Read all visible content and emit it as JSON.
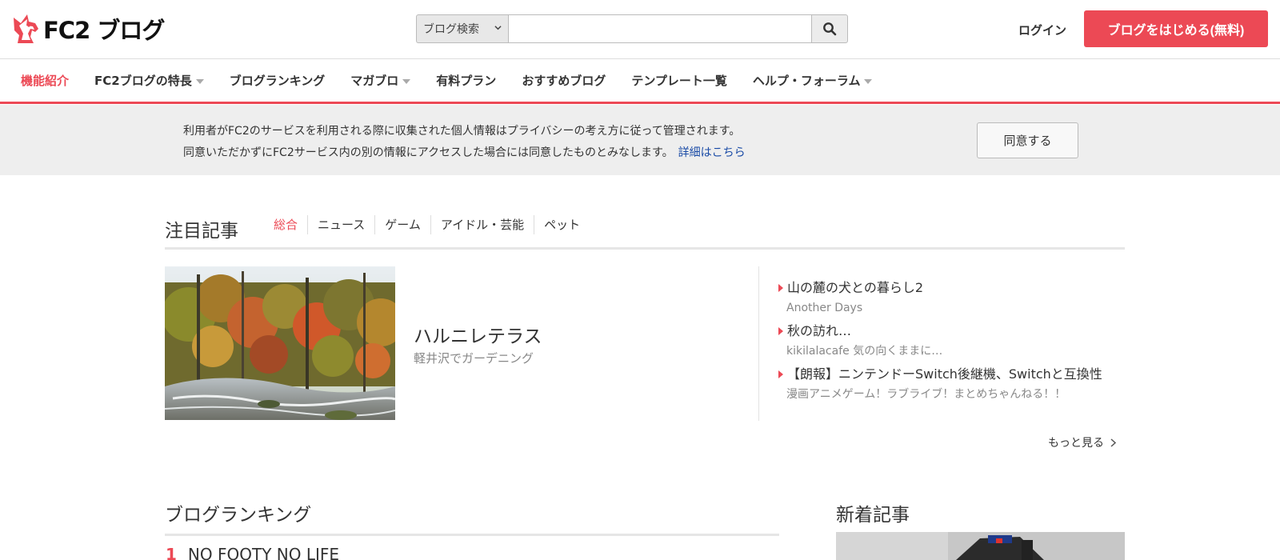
{
  "header": {
    "logo_text": "FC2 ブログ",
    "search_select": "ブログ検索",
    "search_placeholder": "",
    "login_label": "ログイン",
    "start_label": "ブログをはじめる(無料)"
  },
  "nav": {
    "items": [
      {
        "label": "機能紹介",
        "active": true,
        "caret": false
      },
      {
        "label": "FC2ブログの特長",
        "active": false,
        "caret": true
      },
      {
        "label": "ブログランキング",
        "active": false,
        "caret": false
      },
      {
        "label": "マガブロ",
        "active": false,
        "caret": true
      },
      {
        "label": "有料プラン",
        "active": false,
        "caret": false
      },
      {
        "label": "おすすめブログ",
        "active": false,
        "caret": false
      },
      {
        "label": "テンプレート一覧",
        "active": false,
        "caret": false
      },
      {
        "label": "ヘルプ・フォーラム",
        "active": false,
        "caret": true
      }
    ]
  },
  "notice": {
    "line1": "利用者がFC2のサービスを利用される際に収集された個人情報はプライバシーの考え方に従って管理されます。",
    "line2": "同意いただかずにFC2サービス内の別の情報にアクセスした場合には同意したものとみなします。",
    "link": "詳細はこちら",
    "agree_label": "同意する"
  },
  "featured": {
    "title": "注目記事",
    "tabs": [
      "総合",
      "ニュース",
      "ゲーム",
      "アイドル・芸能",
      "ペット"
    ],
    "active_tab": 0,
    "main": {
      "title": "ハルニレテラス",
      "subtitle": "軽井沢でガーデニング"
    },
    "list": [
      {
        "title": "山の麓の犬との暮らし2",
        "blog": "Another Days"
      },
      {
        "title": "秋の訪れ…",
        "blog": "kikilalacafe 気の向くままに…"
      },
      {
        "title": "【朗報】ニンテンドーSwitch後継機、Switchと互換性",
        "blog": "漫画アニメゲーム！ラブライブ！まとめちゃんねる！！"
      }
    ],
    "more_label": "もっと見る"
  },
  "ranking": {
    "title": "ブログランキング",
    "first": {
      "rank": "1",
      "name": "NO FOOTY NO LIFE"
    }
  },
  "new_articles": {
    "title": "新着記事"
  },
  "colors": {
    "accent": "#ec4955",
    "link": "#1a4ba6",
    "notice_bg": "#eeeeee"
  },
  "icons": {
    "logo": "fc2-unicorn-logo-icon",
    "search": "search-icon",
    "select": "chevron-down-icon",
    "more": "chevron-right-icon"
  }
}
